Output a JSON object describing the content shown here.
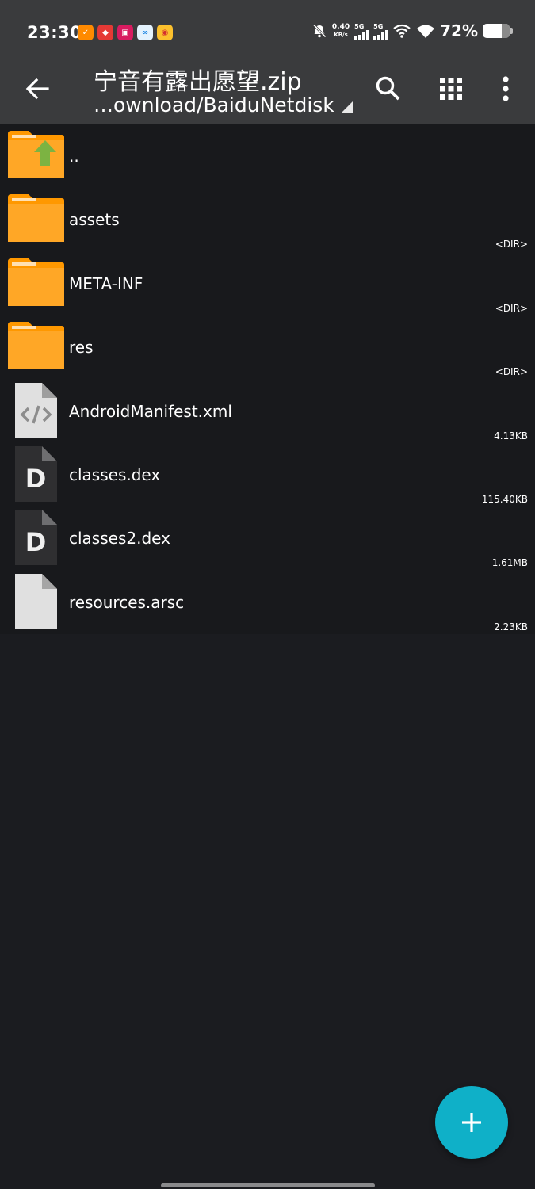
{
  "status_bar": {
    "time": "23:30",
    "net_speed_value": "0.40",
    "net_speed_unit": "KB/s",
    "sim1_label": "5G",
    "sim2_label": "5G",
    "battery_percent": "72%",
    "battery_level": 0.72,
    "notification_icons": [
      "taobao-icon",
      "app-red-icon",
      "taobao-promo-icon",
      "baidu-netdisk-icon",
      "weibo-icon"
    ]
  },
  "toolbar": {
    "title": "宁音有露出愿望.zip",
    "path": "…ownload/BaiduNetdisk"
  },
  "files": [
    {
      "name": "..",
      "size": "",
      "type": "parent-folder"
    },
    {
      "name": "assets",
      "size": "<DIR>",
      "type": "folder"
    },
    {
      "name": "META-INF",
      "size": "<DIR>",
      "type": "folder"
    },
    {
      "name": "res",
      "size": "<DIR>",
      "type": "folder"
    },
    {
      "name": "AndroidManifest.xml",
      "size": "4.13KB",
      "type": "xml"
    },
    {
      "name": "classes.dex",
      "size": "115.40KB",
      "type": "dex"
    },
    {
      "name": "classes2.dex",
      "size": "1.61MB",
      "type": "dex"
    },
    {
      "name": "resources.arsc",
      "size": "2.23KB",
      "type": "file"
    }
  ],
  "colors": {
    "background": "#1b1c20",
    "toolbar": "#3a3b3d",
    "folder": "#ff9800",
    "fab": "#0fb0c8"
  }
}
